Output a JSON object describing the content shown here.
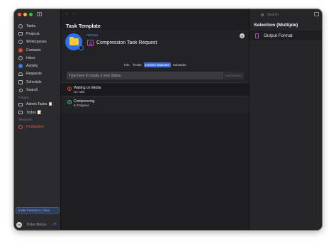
{
  "colors": {
    "accent": "#3d6fd0",
    "link": "#6ea2ff",
    "on_hold": "#d8502f",
    "in_progress": "#2fb9a8",
    "task_icon": "#b34bbf",
    "production": "#e05a4a"
  },
  "sidebar": {
    "items": [
      {
        "label": "Tasks",
        "icon": "circle-icon"
      },
      {
        "label": "Projects",
        "icon": "folder-icon"
      },
      {
        "label": "Workspaces",
        "icon": "circle-icon"
      },
      {
        "label": "Contacts",
        "icon": "contacts-icon"
      },
      {
        "label": "Inbox",
        "icon": "inbox-icon"
      },
      {
        "label": "Activity",
        "icon": "activity-icon"
      },
      {
        "label": "Requests",
        "icon": "requests-icon"
      },
      {
        "label": "Schedule",
        "icon": "calendar-icon"
      },
      {
        "label": "Search",
        "icon": "search-icon"
      }
    ],
    "folders_header": "Folders",
    "folders": [
      {
        "label": "Admin Tasks",
        "emoji": "📋"
      },
      {
        "label": "Todos",
        "emoji": "📝"
      }
    ],
    "shortcuts_header": "Shortcuts",
    "shortcuts": [
      {
        "label": "Production"
      }
    ],
    "invite_label": "Invite Friends to Cilius",
    "user_name": "Peter Moore",
    "avatar_text": "PM"
  },
  "main": {
    "title": "Task Template",
    "parent_link": "AR Post",
    "task_title": "Compression Task Request",
    "more_label": "•••",
    "tabs": [
      {
        "label": "Info",
        "active": false
      },
      {
        "label": "Fields",
        "active": false
      },
      {
        "label": "Custom Statuses",
        "active": true
      },
      {
        "label": "Subtasks",
        "active": false
      }
    ],
    "status_placeholder": "Type here to create a new Status",
    "add_status_label": "Add Status",
    "statuses": [
      {
        "name": "Waiting on Media",
        "state": "On Hold"
      },
      {
        "name": "Compressing",
        "state": "In Progress"
      }
    ]
  },
  "right": {
    "search_placeholder": "Search",
    "title": "Selection (Multiple)",
    "item_label": "Output Format"
  }
}
